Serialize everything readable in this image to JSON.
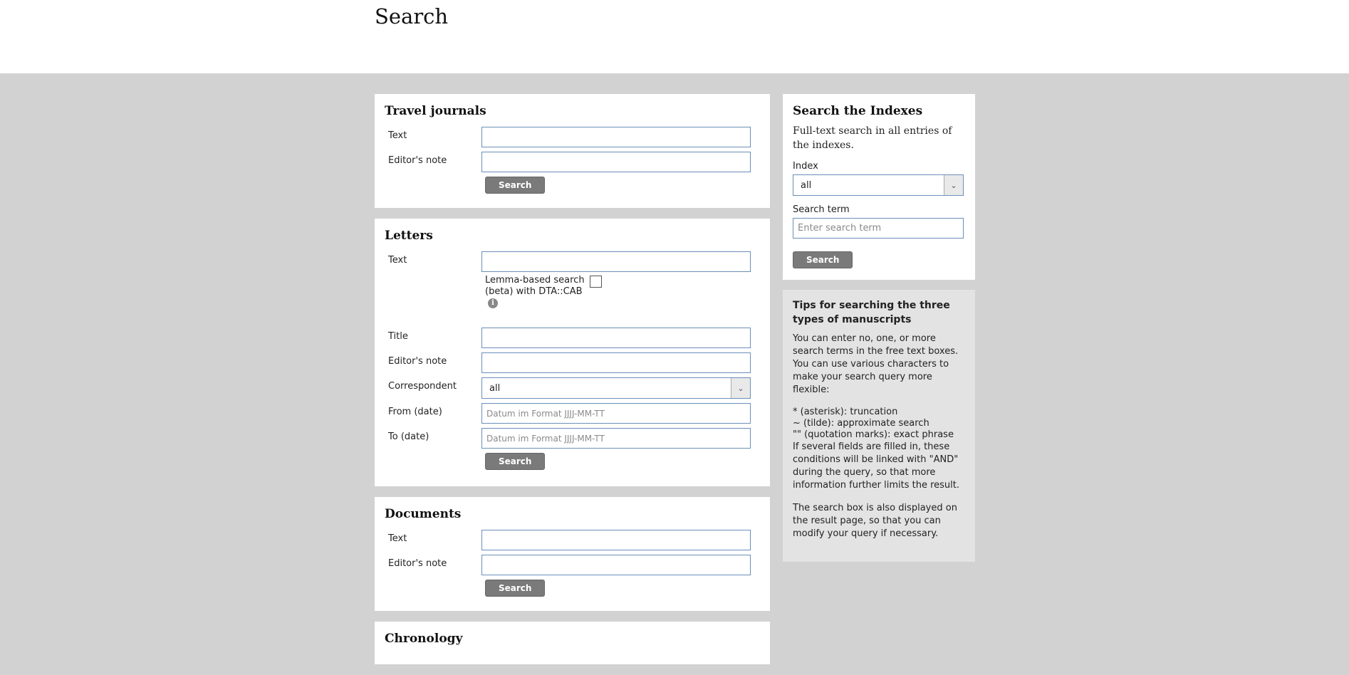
{
  "page": {
    "title": "Search"
  },
  "travel_journals": {
    "heading": "Travel journals",
    "text_label": "Text",
    "editors_note_label": "Editor's note",
    "search_button": "Search"
  },
  "letters": {
    "heading": "Letters",
    "text_label": "Text",
    "lemma_label": "Lemma-based search (beta) with DTA::CAB",
    "lemma_checked": false,
    "title_label": "Title",
    "editors_note_label": "Editor's note",
    "correspondent_label": "Correspondent",
    "correspondent_value": "all",
    "from_date_label": "From (date)",
    "from_date_placeholder": "Datum im Format JJJJ-MM-TT",
    "to_date_label": "To (date)",
    "to_date_placeholder": "Datum im Format JJJJ-MM-TT",
    "search_button": "Search"
  },
  "documents": {
    "heading": "Documents",
    "text_label": "Text",
    "editors_note_label": "Editor's note",
    "search_button": "Search"
  },
  "chronology": {
    "heading": "Chronology"
  },
  "indexes": {
    "heading": "Search the Indexes",
    "description": "Full-text search in all entries of the indexes.",
    "index_label": "Index",
    "index_value": "all",
    "search_term_label": "Search term",
    "search_term_placeholder": "Enter search term",
    "search_button": "Search"
  },
  "tips": {
    "heading": "Tips for searching the three types of manuscripts",
    "intro": "You can enter no, one, or more search terms in the free text boxes. You can use various characters to make your search query more flexible:",
    "rules": [
      "* (asterisk): truncation",
      "~ (tilde): approximate search",
      "\"\" (quotation marks): exact phrase",
      "If several fields are filled in, these conditions will be linked with \"AND\" during the query, so that more information further limits the result."
    ],
    "outro": "The search box is also displayed on the result page, so that you can modify your query if necessary."
  }
}
